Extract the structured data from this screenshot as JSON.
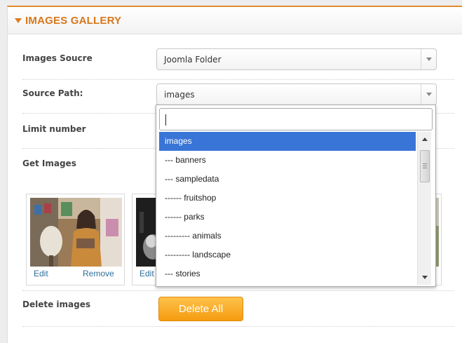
{
  "panel": {
    "title": "IMAGES GALLERY"
  },
  "form": {
    "images_source": {
      "label": "Images Soucre",
      "value": "Joomla Folder"
    },
    "source_path": {
      "label": "Source Path:",
      "value": "images"
    },
    "limit_number": {
      "label": "Limit number"
    },
    "get_images": {
      "label": "Get Images"
    },
    "delete_images": {
      "label": "Delete images",
      "button": "Delete All"
    }
  },
  "thumbnails": {
    "first": {
      "edit": "Edit",
      "remove": "Remove"
    },
    "second": {
      "edit": "Edit"
    }
  },
  "dropdown": {
    "search_value": "",
    "items": [
      "images",
      "--- banners",
      "--- sampledata",
      "------ fruitshop",
      "------ parks",
      "--------- animals",
      "--------- landscape",
      "--- stories"
    ],
    "selected_index": 0
  },
  "colors": {
    "accent": "#d8771b",
    "selection": "#3875d7",
    "button": "#f59b10",
    "link": "#2f6e9b"
  },
  "icons": [
    "collapse-caret-icon",
    "chevron-down-icon",
    "scroll-up-icon",
    "scroll-down-icon"
  ]
}
